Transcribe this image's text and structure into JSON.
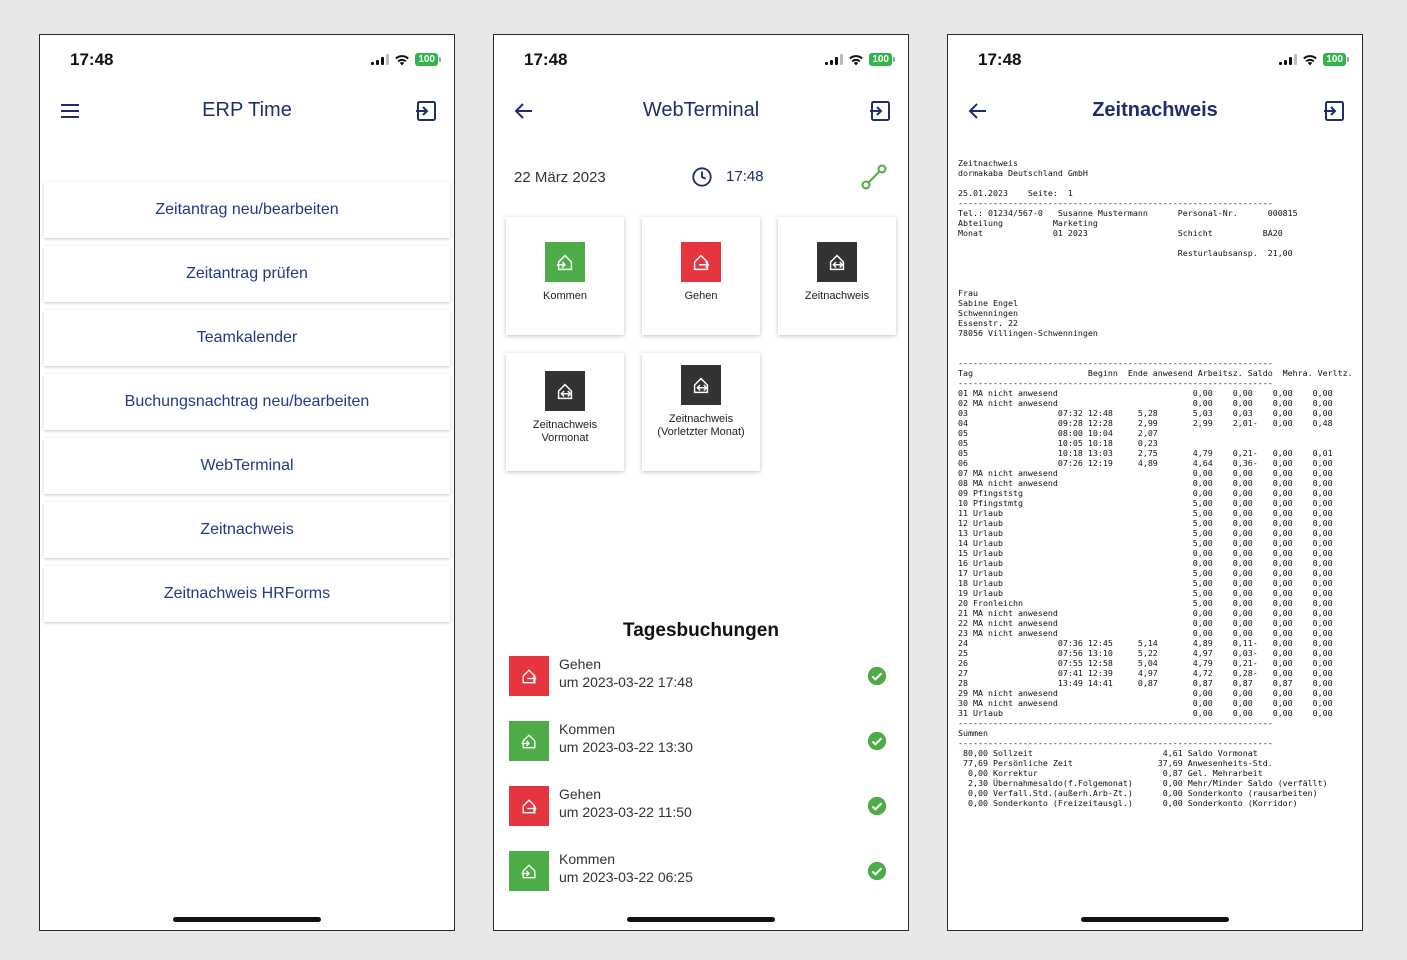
{
  "status": {
    "time": "17:48",
    "battery": "100"
  },
  "screen1": {
    "title": "ERP Time",
    "items": [
      "Zeitantrag neu/bearbeiten",
      "Zeitantrag prüfen",
      "Teamkalender",
      "Buchungsnachtrag neu/bearbeiten",
      "WebTerminal",
      "Zeitnachweis",
      "Zeitnachweis HRForms"
    ]
  },
  "screen2": {
    "title": "WebTerminal",
    "date": "22 März 2023",
    "time": "17:48",
    "tiles": {
      "kommen": "Kommen",
      "gehen": "Gehen",
      "zeitnachweis": "Zeitnachweis",
      "vormonat": "Zeitnachweis Vormonat",
      "vorletzter": "Zeitnachweis (Vorletzter Monat)"
    },
    "bookings_title": "Tagesbuchungen",
    "bookings": [
      {
        "type": "Gehen",
        "time": "um 2023-03-22 17:48"
      },
      {
        "type": "Kommen",
        "time": "um 2023-03-22 13:30"
      },
      {
        "type": "Gehen",
        "time": "um 2023-03-22 11:50"
      },
      {
        "type": "Kommen",
        "time": "um 2023-03-22 06:25"
      }
    ]
  },
  "screen3": {
    "title": "Zeitnachweis",
    "report": "Zeitnachweis\ndormakaba Deutschland GmbH\n\n25.01.2023    Seite:  1\n---------------------------------------------------------------\nTel.: 01234/567-0   Susanne Mustermann      Personal-Nr.      000815\nAbteilung          Marketing\nMonat              01 2023                  Schicht          BA20\n\n                                            Resturlaubsansp.  21,00\n\n\n\nFrau\nSabine Engel\nSchwenningen\nEssenstr. 22\n78056 Villingen-Schwenningen\n\n\n---------------------------------------------------------------\nTag                       Beginn  Ende anwesend Arbeitsz. Saldo  Mehra. Verltz.\n---------------------------------------------------------------\n01 MA nicht anwesend                           0,00    0,00    0,00    0,00\n02 MA nicht anwesend                           0,00    0,00    0,00    0,00\n03                  07:32 12:48     5,28       5,03    0,03    0,00    0,00\n04                  09:28 12:28     2,99       2,99    2,01-   0,00    0,48\n05                  08:00 10:04     2,07\n05                  10:05 10:18     0,23\n05                  10:18 13:03     2,75       4,79    0,21-   0,00    0,01\n06                  07:26 12:19     4,89       4,64    0,36-   0,00    0,00\n07 MA nicht anwesend                           0,00    0,00    0,00    0,00\n08 MA nicht anwesend                           0,00    0,00    0,00    0,00\n09 Pfingststg                                  0,00    0,00    0,00    0,00\n10 Pfingstmtg                                  5,00    0,00    0,00    0,00\n11 Urlaub                                      5,00    0,00    0,00    0,00\n12 Urlaub                                      5,00    0,00    0,00    0,00\n13 Urlaub                                      5,00    0,00    0,00    0,00\n14 Urlaub                                      5,00    0,00    0,00    0,00\n15 Urlaub                                      0,00    0,00    0,00    0,00\n16 Urlaub                                      0,00    0,00    0,00    0,00\n17 Urlaub                                      5,00    0,00    0,00    0,00\n18 Urlaub                                      5,00    0,00    0,00    0,00\n19 Urlaub                                      5,00    0,00    0,00    0,00\n20 Fronleichn                                  5,00    0,00    0,00    0,00\n21 MA nicht anwesend                           0,00    0,00    0,00    0,00\n22 MA nicht anwesend                           0,00    0,00    0,00    0,00\n23 MA nicht anwesend                           0,00    0,00    0,00    0,00\n24                  07:36 12:45     5,14       4,89    0,11-   0,00    0,00\n25                  07:56 13:10     5,22       4,97    0,03-   0,00    0,00\n26                  07:55 12:58     5,04       4,79    0,21-   0,00    0,00\n27                  07:41 12:39     4,97       4,72    0,28-   0,00    0,00\n28                  13:49 14:41     0,87       0,87    0,87    0,87    0,00\n29 MA nicht anwesend                           0,00    0,00    0,00    0,00\n30 MA nicht anwesend                           0,00    0,00    0,00    0,00\n31 Urlaub                                      0,00    0,00    0,00    0,00\n---------------------------------------------------------------\nSummen\n---------------------------------------------------------------\n 80,00 Sollzeit                          4,61 Saldo Vormonat\n 77,69 Persönliche Zeit                 37,69 Anwesenheits-Std.\n  0,00 Korrektur                         0,87 Gel. Mehrarbeit\n  2,30 Übernahmesaldo(f.Folgemonat)      0,00 Mehr/Minder Saldo (verfällt)\n  0,00 Verfall.Std.(außerh.Arb-Zt.)      0,00 Sonderkonto (rausarbeiten)\n  0,00 Sonderkonto (Freizeitausgl.)      0,00 Sonderkonto (Korridor)"
  },
  "colors": {
    "accent": "#1f3a8a",
    "kommen": "#4eac48",
    "gehen": "#e7353f",
    "zeitnachweis": "#333333",
    "check": "#4eac48"
  },
  "icons": {
    "menu": "hamburger-icon",
    "logout": "logout-icon",
    "back": "back-arrow-icon",
    "clock": "clock-icon",
    "link": "link-icon",
    "check": "check-circle-icon"
  }
}
